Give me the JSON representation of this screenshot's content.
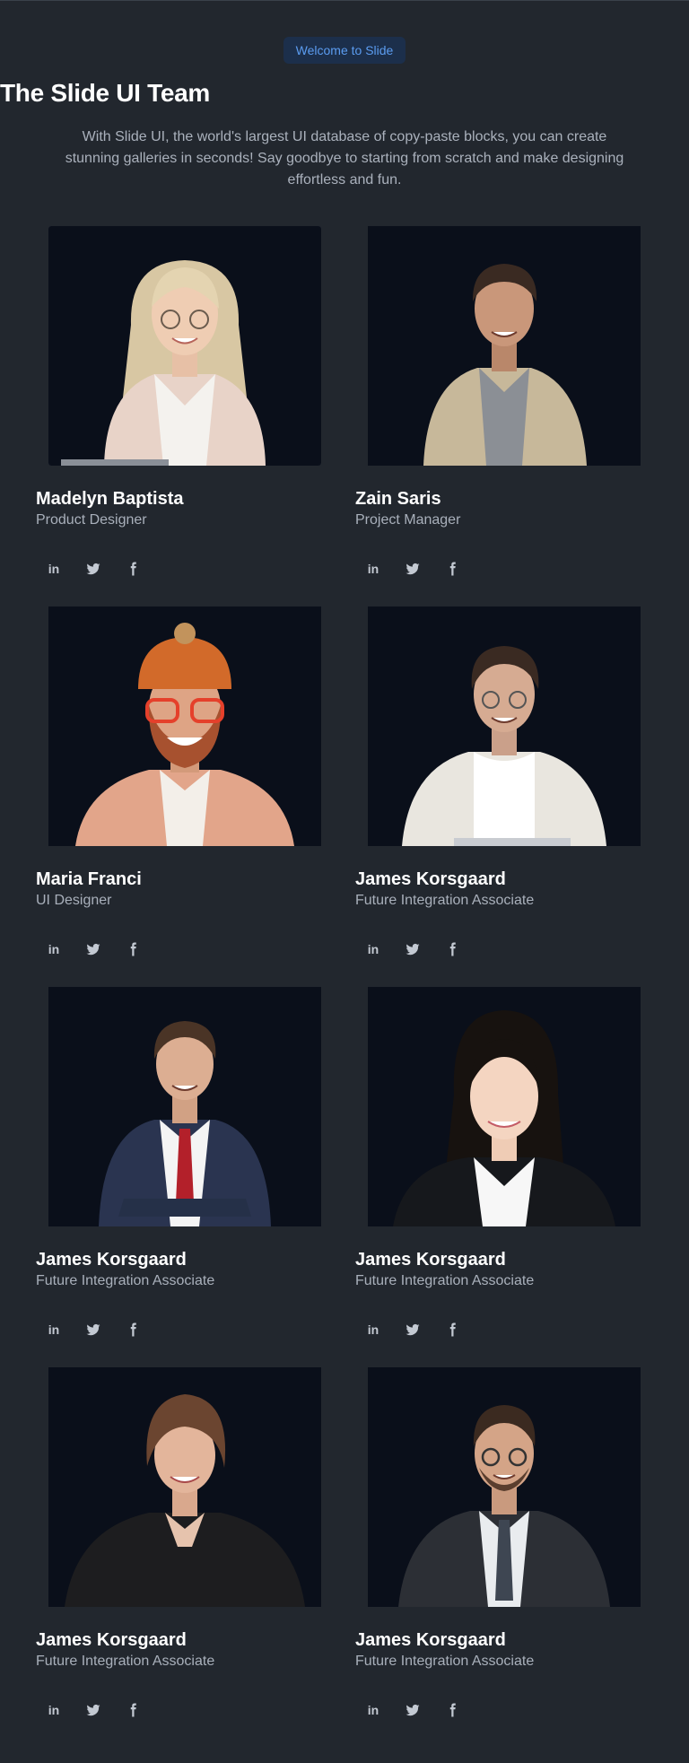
{
  "header": {
    "badge": "Welcome to Slide",
    "title": "The Slide UI Team",
    "subtitle": "With Slide UI, the world's largest UI database of copy-paste blocks, you can create stunning galleries in seconds! Say goodbye to starting from scratch and make designing effortless and fun."
  },
  "colors": {
    "background": "#22272e",
    "photo_background": "#0a0f1a",
    "badge_background": "#1c2f4b",
    "badge_text": "#5b9cf0",
    "muted_text": "#a9b0bb"
  },
  "social_icons": [
    "linkedin-icon",
    "twitter-icon",
    "facebook-icon"
  ],
  "team": [
    {
      "name": "Madelyn Baptista",
      "role": "Product Designer"
    },
    {
      "name": "Zain Saris",
      "role": "Project Manager"
    },
    {
      "name": "Maria Franci",
      "role": "UI Designer"
    },
    {
      "name": "James Korsgaard",
      "role": "Future Integration Associate"
    },
    {
      "name": "James Korsgaard",
      "role": "Future Integration Associate"
    },
    {
      "name": "James Korsgaard",
      "role": "Future Integration Associate"
    },
    {
      "name": "James Korsgaard",
      "role": "Future Integration Associate"
    },
    {
      "name": "James Korsgaard",
      "role": "Future Integration Associate"
    }
  ]
}
